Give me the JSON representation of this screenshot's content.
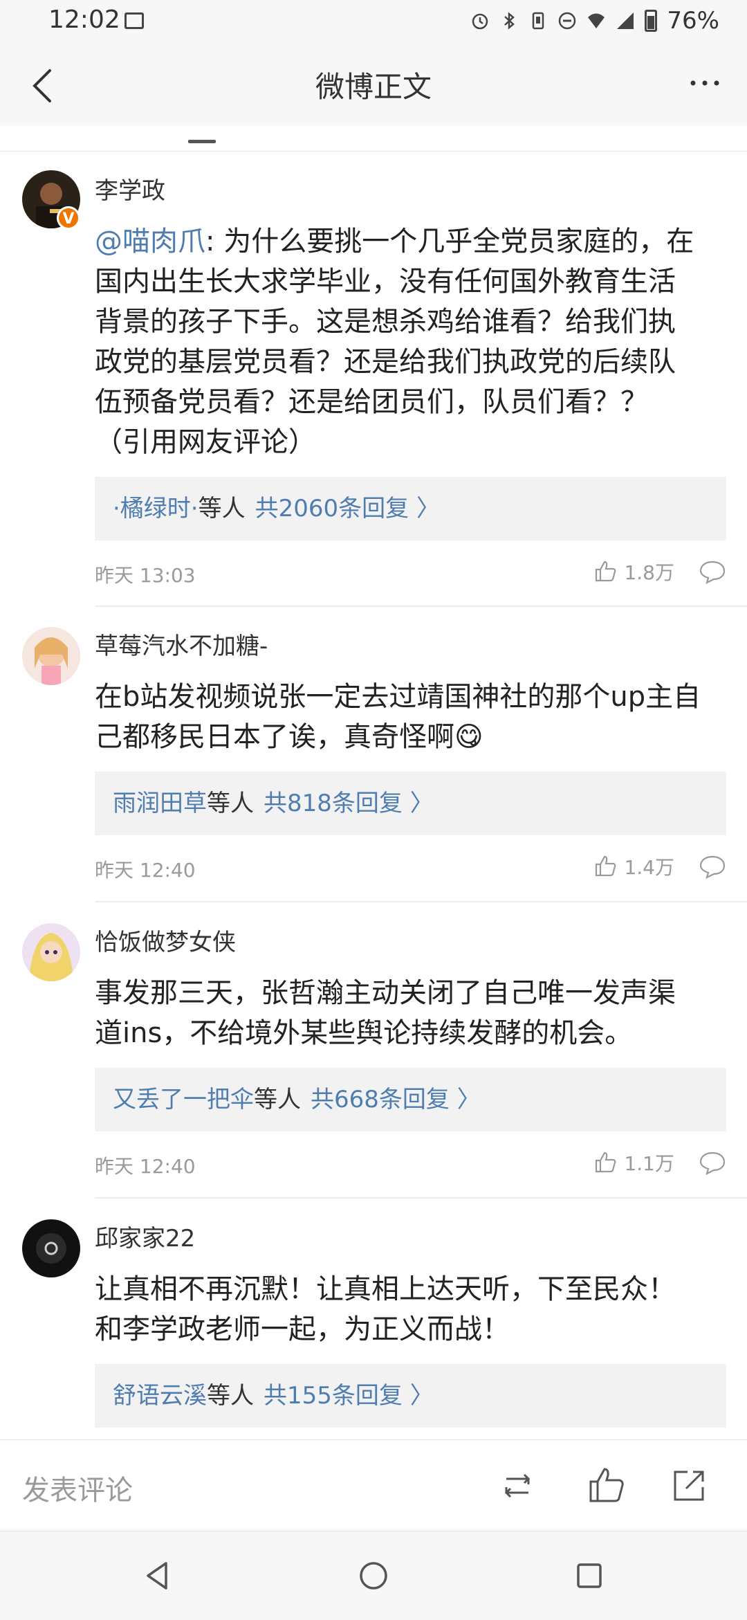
{
  "status_bar": {
    "time": "12:02",
    "battery": "76%",
    "icons": [
      "image-icon",
      "alarm-icon",
      "bluetooth-icon",
      "vibrate-icon",
      "dnd-icon",
      "wifi-icon",
      "signal-icon",
      "battery-icon"
    ]
  },
  "nav": {
    "title": "微博正文",
    "back_icon": "back-arrow-icon",
    "more_icon": "more-icon"
  },
  "comments": [
    {
      "author": "李学政",
      "verified": true,
      "badge": "V",
      "mention": "@喵肉爪",
      "text_line1": ": 为什么要挑一个几乎全党员家庭的，在",
      "text_line2": "国内出生长大求学毕业，没有任何国外教育生活",
      "text_line3": "背景的孩子下手。这是想杀鸡给谁看？给我们执",
      "text_line4": "政党的基层党员看？还是给我们执政党的后续队",
      "text_line5": "伍预备党员看？还是给团员们，队员们看？？",
      "text_line6": "（引用网友评论）",
      "reply_name": "·橘绿时·",
      "reply_suffix": "等人",
      "reply_count": "共2060条回复 〉",
      "time": "昨天 13:03",
      "likes": "1.8万"
    },
    {
      "author": "草莓汽水不加糖-",
      "text_line1": "在b站发视频说张一定去过靖国神社的那个up主自",
      "text_line2": "己都移民日本了诶，真奇怪啊😋",
      "reply_name": "雨润田草",
      "reply_suffix": "等人",
      "reply_count": "共818条回复 〉",
      "time": "昨天 12:40",
      "likes": "1.4万"
    },
    {
      "author": "恰饭做梦女侠",
      "text_line1": "事发那三天，张哲瀚主动关闭了自己唯一发声渠",
      "text_line2": "道ins，不给境外某些舆论持续发酵的机会。",
      "reply_name": "又丢了一把伞",
      "reply_suffix": "等人",
      "reply_count": "共668条回复 〉",
      "time": "昨天 12:40",
      "likes": "1.1万"
    },
    {
      "author": "邱家家22",
      "text_line1": "让真相不再沉默！让真相上达天听，下至民众！",
      "text_line2": "和李学政老师一起，为正义而战！",
      "reply_name": "舒语云溪",
      "reply_suffix": "等人",
      "reply_count": "共155条回复 〉"
    }
  ],
  "bottom_bar": {
    "comment_placeholder": "发表评论",
    "icons": [
      "repost-icon",
      "like-icon",
      "share-icon"
    ]
  },
  "system_nav": {
    "icons": [
      "nav-back-icon",
      "nav-home-icon",
      "nav-recents-icon"
    ]
  },
  "colors": {
    "link": "#507daf",
    "meta": "#9a9a9a",
    "reply_bg": "#f2f2f2",
    "verified": "#f07400"
  }
}
